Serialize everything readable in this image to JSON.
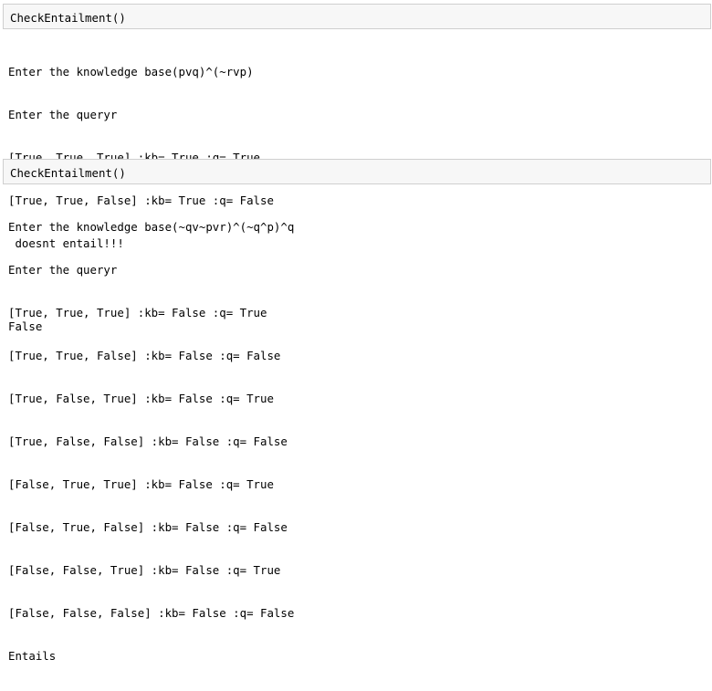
{
  "cells": [
    {
      "input": "CheckEntailment()",
      "output_lines": [
        "Enter the knowledge base(pvq)^(~rvp)",
        "Enter the queryr",
        "[True, True, True] :kb= True :q= True",
        "[True, True, False] :kb= True :q= False",
        " doesnt entail!!!"
      ],
      "result": "False"
    },
    {
      "input": "CheckEntailment()",
      "output_lines": [
        "Enter the knowledge base(~qv~pvr)^(~q^p)^q",
        "Enter the queryr",
        "[True, True, True] :kb= False :q= True",
        "[True, True, False] :kb= False :q= False",
        "[True, False, True] :kb= False :q= True",
        "[True, False, False] :kb= False :q= False",
        "[False, True, True] :kb= False :q= True",
        "[False, True, False] :kb= False :q= False",
        "[False, False, True] :kb= False :q= True",
        "[False, False, False] :kb= False :q= False",
        "Entails"
      ]
    }
  ]
}
